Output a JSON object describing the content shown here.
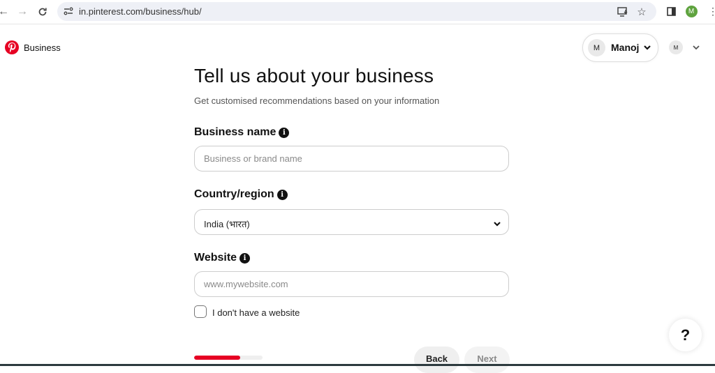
{
  "browser": {
    "url": "in.pinterest.com/business/hub/",
    "profile_initial": "M",
    "profile_color": "#5fa33f"
  },
  "header": {
    "logo_text": "Business",
    "brand_color": "#e60023",
    "user_name": "Manoj",
    "user_initial": "M",
    "secondary_avatar_initial": "M"
  },
  "form": {
    "title": "Tell us about your business",
    "subtitle": "Get customised recommendations based on your information",
    "business_name": {
      "label": "Business name",
      "placeholder": "Business or brand name",
      "value": ""
    },
    "country": {
      "label": "Country/region",
      "value": "India (भारत)"
    },
    "website": {
      "label": "Website",
      "placeholder": "www.mywebsite.com",
      "value": ""
    },
    "no_website_checkbox": {
      "label": "I don't have a website",
      "checked": false
    },
    "progress_fraction": 0.67,
    "back_label": "Back",
    "next_label": "Next"
  },
  "help": {
    "label": "?"
  }
}
